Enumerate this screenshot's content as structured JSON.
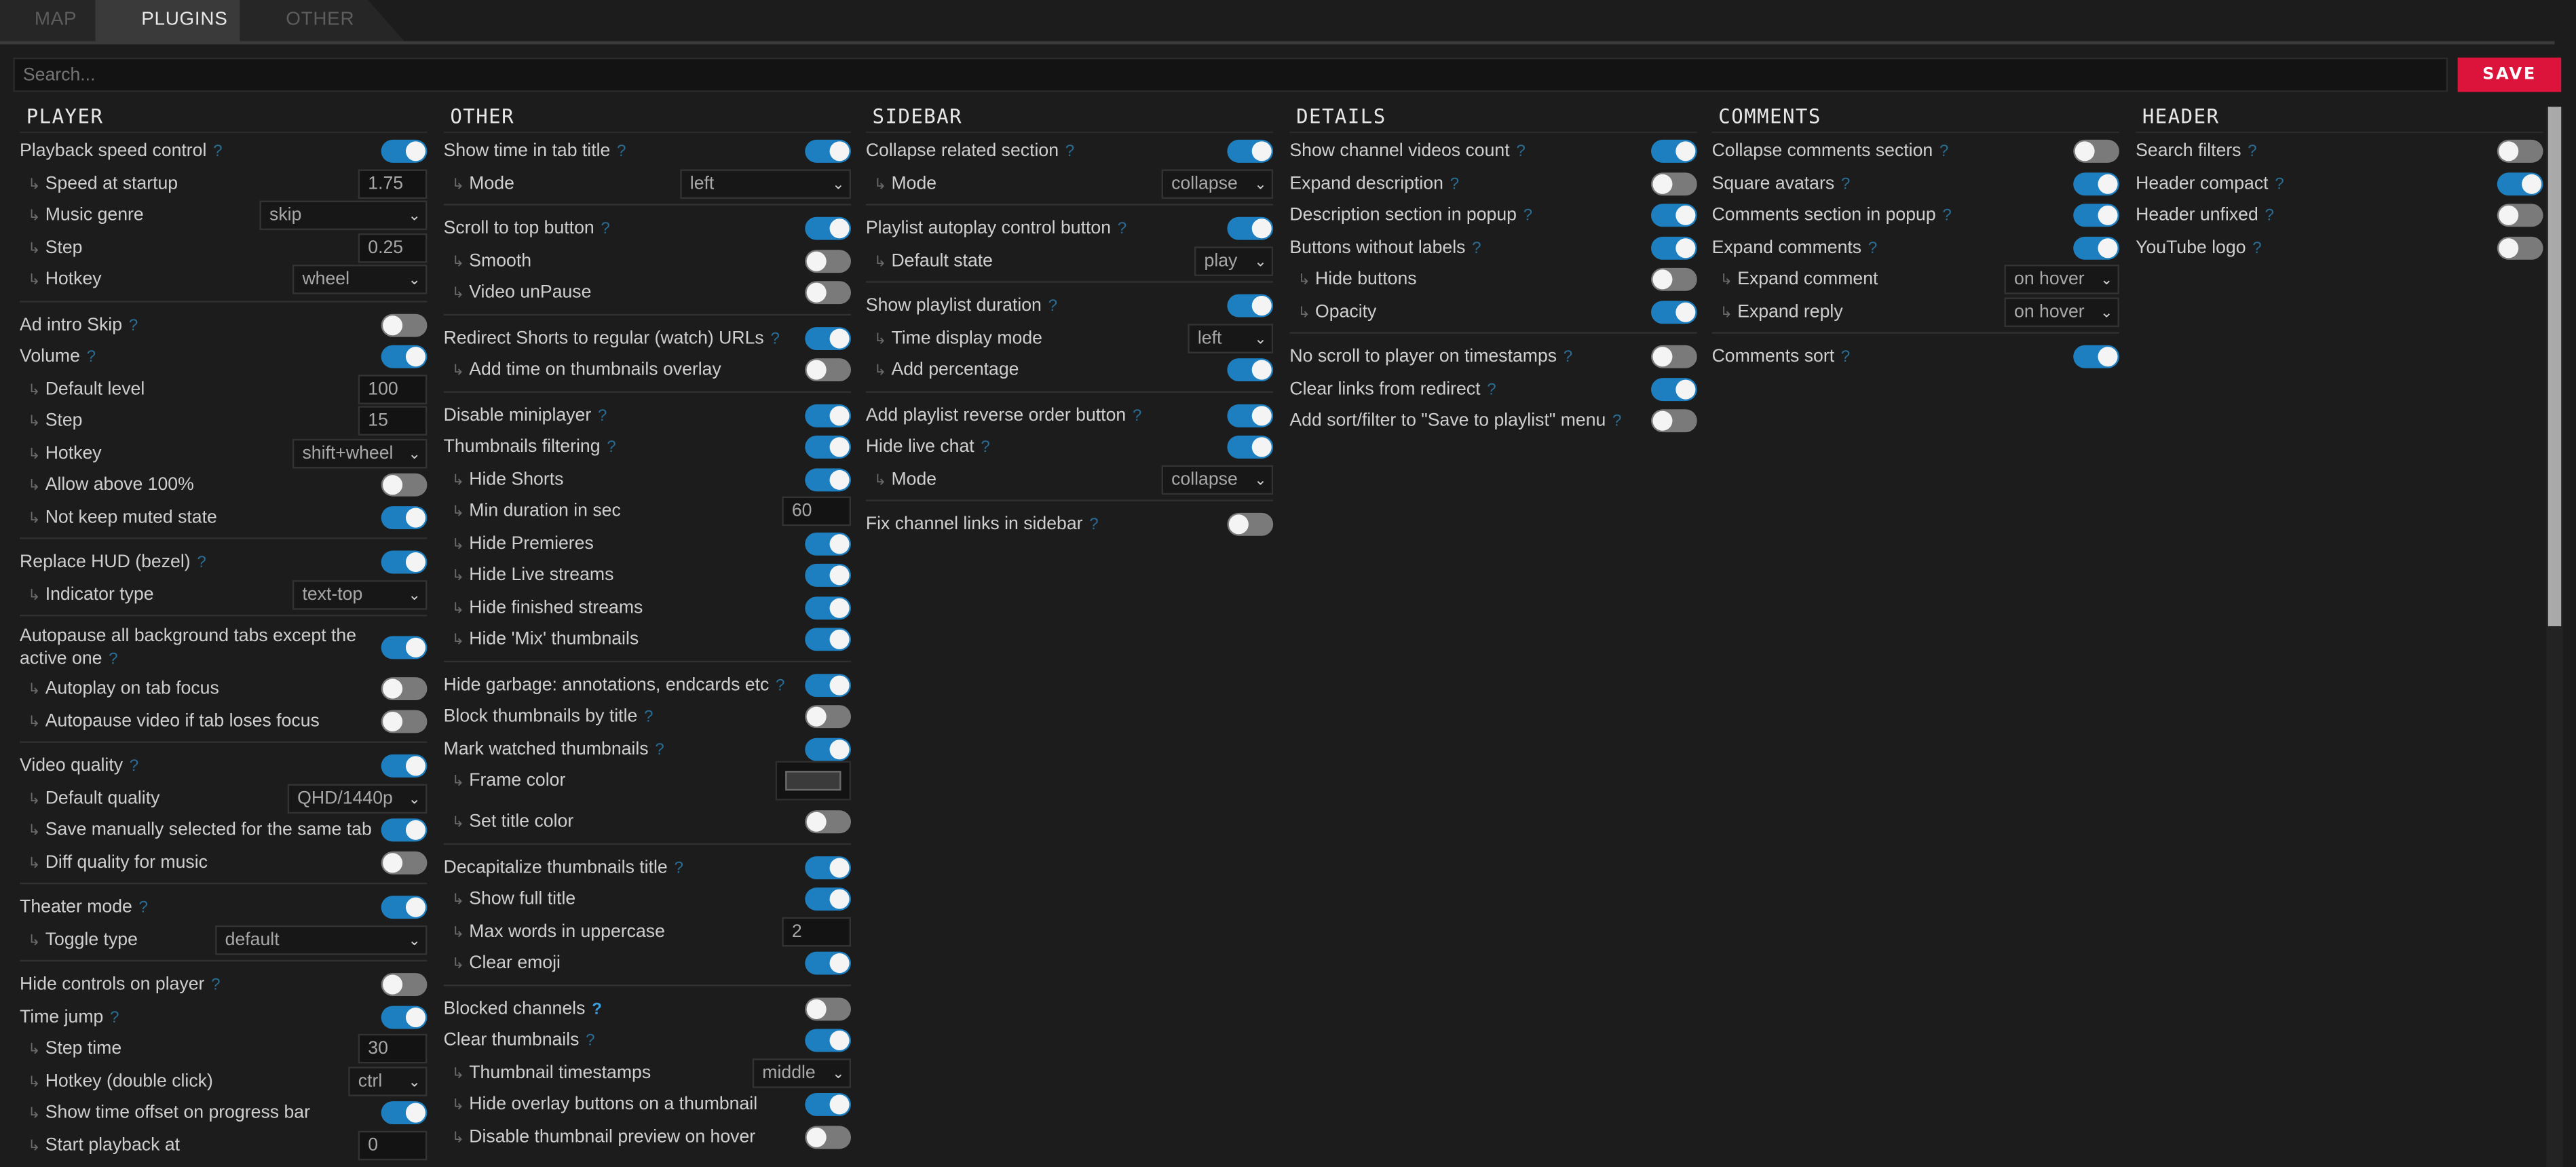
{
  "tabs": [
    "MAP",
    "PLUGINS",
    "OTHER"
  ],
  "search": {
    "placeholder": "Search..."
  },
  "save_label": "SAVE",
  "help_glyph": "?",
  "arrow_glyph": "↳",
  "columns": [
    {
      "title": "PLAYER",
      "rows": [
        {
          "t": "opt",
          "label": "Playback speed control",
          "help": true,
          "on": true
        },
        {
          "t": "sub",
          "label": "Speed at startup",
          "input": "1.75",
          "w": 42
        },
        {
          "t": "sub",
          "label": "Music genre",
          "select": "skip",
          "w": 102
        },
        {
          "t": "sub",
          "label": "Step",
          "input": "0.25",
          "w": 42
        },
        {
          "t": "sub",
          "label": "Hotkey",
          "select": "wheel",
          "w": 82
        },
        {
          "t": "sep"
        },
        {
          "t": "opt",
          "label": "Ad intro Skip",
          "help": true,
          "on": false
        },
        {
          "t": "opt",
          "label": "Volume",
          "help": true,
          "on": true
        },
        {
          "t": "sub",
          "label": "Default level",
          "input": "100",
          "w": 42
        },
        {
          "t": "sub",
          "label": "Step",
          "input": "15",
          "w": 42
        },
        {
          "t": "sub",
          "label": "Hotkey",
          "select": "shift+wheel",
          "w": 82
        },
        {
          "t": "sub",
          "label": "Allow above 100%",
          "on": false
        },
        {
          "t": "sub",
          "label": "Not keep muted state",
          "on": true
        },
        {
          "t": "sep"
        },
        {
          "t": "opt",
          "label": "Replace HUD (bezel)",
          "help": true,
          "on": true
        },
        {
          "t": "sub",
          "label": "Indicator type",
          "select": "text-top",
          "w": 82
        },
        {
          "t": "sep"
        },
        {
          "t": "opt2",
          "label": "Autopause all background tabs except the",
          "label2": "active one",
          "help": true,
          "on": true
        },
        {
          "t": "sub",
          "label": "Autoplay on tab focus",
          "on": false
        },
        {
          "t": "sub",
          "label": "Autopause video if tab loses focus",
          "on": false
        },
        {
          "t": "sep"
        },
        {
          "t": "opt",
          "label": "Video quality",
          "help": true,
          "on": true
        },
        {
          "t": "sub",
          "label": "Default quality",
          "select": "QHD/1440p",
          "w": 85
        },
        {
          "t": "sub",
          "label": "Save manually selected for the same tab",
          "on": true
        },
        {
          "t": "sub",
          "label": "Diff quality for music",
          "on": false
        },
        {
          "t": "sep"
        },
        {
          "t": "opt",
          "label": "Theater mode",
          "help": true,
          "on": true
        },
        {
          "t": "sub",
          "label": "Toggle type",
          "select": "default",
          "w": 129
        },
        {
          "t": "sep"
        },
        {
          "t": "opt",
          "label": "Hide controls on player",
          "help": true,
          "on": false
        },
        {
          "t": "opt",
          "label": "Time jump",
          "help": true,
          "on": true
        },
        {
          "t": "sub",
          "label": "Step time",
          "input": "30",
          "w": 42
        },
        {
          "t": "sub",
          "label": "Hotkey (double click)",
          "select": "ctrl",
          "w": 48
        },
        {
          "t": "sub",
          "label": "Show time offset on progress bar",
          "on": true
        },
        {
          "t": "sub",
          "label": "Start playback at",
          "input": "0",
          "w": 42
        }
      ]
    },
    {
      "title": "OTHER",
      "rows": [
        {
          "t": "opt",
          "label": "Show time in tab title",
          "help": true,
          "on": true
        },
        {
          "t": "sub",
          "label": "Mode",
          "select": "left",
          "w": 104
        },
        {
          "t": "sep"
        },
        {
          "t": "opt",
          "label": "Scroll to top button",
          "help": true,
          "on": true
        },
        {
          "t": "sub",
          "label": "Smooth",
          "on": false
        },
        {
          "t": "sub",
          "label": "Video unPause",
          "on": false
        },
        {
          "t": "sep"
        },
        {
          "t": "opt",
          "label": "Redirect Shorts to regular (watch) URLs",
          "help": true,
          "on": true
        },
        {
          "t": "sub",
          "label": "Add time on thumbnails overlay",
          "on": false
        },
        {
          "t": "sep"
        },
        {
          "t": "opt",
          "label": "Disable miniplayer",
          "help": true,
          "on": true
        },
        {
          "t": "opt",
          "label": "Thumbnails filtering",
          "help": true,
          "on": true
        },
        {
          "t": "sub",
          "label": "Hide Shorts",
          "on": true
        },
        {
          "t": "sub",
          "label": "Min duration in sec",
          "input": "60",
          "w": 42
        },
        {
          "t": "sub",
          "label": "Hide Premieres",
          "on": true
        },
        {
          "t": "sub",
          "label": "Hide Live streams",
          "on": true
        },
        {
          "t": "sub",
          "label": "Hide finished streams",
          "on": true
        },
        {
          "t": "sub",
          "label": "Hide 'Mix' thumbnails",
          "on": true
        },
        {
          "t": "sep"
        },
        {
          "t": "opt",
          "label": "Hide garbage: annotations, endcards etc",
          "help": true,
          "on": true
        },
        {
          "t": "opt",
          "label": "Block thumbnails by title",
          "help": true,
          "on": false
        },
        {
          "t": "opt",
          "label": "Mark watched thumbnails",
          "help": true,
          "on": true
        },
        {
          "t": "subc",
          "label": "Frame color",
          "color": "#3b3b3b"
        },
        {
          "t": "sub",
          "label": "Set title color",
          "on": false
        },
        {
          "t": "sep"
        },
        {
          "t": "opt",
          "label": "Decapitalize thumbnails title",
          "help": true,
          "on": true
        },
        {
          "t": "sub",
          "label": "Show full title",
          "on": true
        },
        {
          "t": "sub",
          "label": "Max words in uppercase",
          "input": "2",
          "w": 42
        },
        {
          "t": "sub",
          "label": "Clear emoji",
          "on": true
        },
        {
          "t": "sep"
        },
        {
          "t": "opt",
          "label": "Blocked channels",
          "help": true,
          "helpBright": true,
          "on": false
        },
        {
          "t": "opt",
          "label": "Clear thumbnails",
          "help": true,
          "on": true
        },
        {
          "t": "sub",
          "label": "Thumbnail timestamps",
          "select": "middle",
          "w": 60
        },
        {
          "t": "sub",
          "label": "Hide overlay buttons on a thumbnail",
          "on": true
        },
        {
          "t": "sub",
          "label": "Disable thumbnail preview on hover",
          "on": false
        }
      ]
    },
    {
      "title": "SIDEBAR",
      "rows": [
        {
          "t": "opt",
          "label": "Collapse related section",
          "help": true,
          "on": true
        },
        {
          "t": "sub",
          "label": "Mode",
          "select": "collapse",
          "w": 68
        },
        {
          "t": "sep"
        },
        {
          "t": "opt",
          "label": "Playlist autoplay control button",
          "help": true,
          "on": true
        },
        {
          "t": "sub",
          "label": "Default state",
          "select": "play",
          "w": 48
        },
        {
          "t": "sep"
        },
        {
          "t": "opt",
          "label": "Show playlist duration",
          "help": true,
          "on": true
        },
        {
          "t": "sub",
          "label": "Time display mode",
          "select": "left",
          "w": 52
        },
        {
          "t": "sub",
          "label": "Add percentage",
          "on": true
        },
        {
          "t": "sep"
        },
        {
          "t": "opt",
          "label": "Add playlist reverse order button",
          "help": true,
          "on": true
        },
        {
          "t": "opt",
          "label": "Hide live chat",
          "help": true,
          "on": true
        },
        {
          "t": "sub",
          "label": "Mode",
          "select": "collapse",
          "w": 68
        },
        {
          "t": "sep"
        },
        {
          "t": "opt",
          "label": "Fix channel links in sidebar",
          "help": true,
          "on": false
        }
      ]
    },
    {
      "title": "DETAILS",
      "rows": [
        {
          "t": "opt",
          "label": "Show channel videos count",
          "help": true,
          "on": true
        },
        {
          "t": "opt",
          "label": "Expand description",
          "help": true,
          "on": false
        },
        {
          "t": "opt",
          "label": "Description section in popup",
          "help": true,
          "on": true
        },
        {
          "t": "opt",
          "label": "Buttons without labels",
          "help": true,
          "on": true
        },
        {
          "t": "sub",
          "label": "Hide buttons",
          "on": false
        },
        {
          "t": "sub",
          "label": "Opacity",
          "on": true
        },
        {
          "t": "sep"
        },
        {
          "t": "opt",
          "label": "No scroll to player on timestamps",
          "help": true,
          "on": false
        },
        {
          "t": "opt",
          "label": "Clear links from redirect",
          "help": true,
          "on": true
        },
        {
          "t": "opt",
          "label": "Add sort/filter to \"Save to playlist\" menu",
          "help": true,
          "on": false
        }
      ]
    },
    {
      "title": "COMMENTS",
      "rows": [
        {
          "t": "opt",
          "label": "Collapse comments section",
          "help": true,
          "on": false
        },
        {
          "t": "opt",
          "label": "Square avatars",
          "help": true,
          "on": true
        },
        {
          "t": "opt",
          "label": "Comments section in popup",
          "help": true,
          "on": true
        },
        {
          "t": "opt",
          "label": "Expand comments",
          "help": true,
          "on": true
        },
        {
          "t": "sub",
          "label": "Expand comment",
          "select": "on hover",
          "w": 70
        },
        {
          "t": "sub",
          "label": "Expand reply",
          "select": "on hover",
          "w": 70
        },
        {
          "t": "sep"
        },
        {
          "t": "opt",
          "label": "Comments sort",
          "help": true,
          "on": true
        }
      ]
    },
    {
      "title": "HEADER",
      "rows": [
        {
          "t": "opt",
          "label": "Search filters",
          "help": true,
          "on": false
        },
        {
          "t": "opt",
          "label": "Header compact",
          "help": true,
          "on": true
        },
        {
          "t": "opt",
          "label": "Header unfixed",
          "help": true,
          "on": false
        },
        {
          "t": "opt",
          "label": "YouTube logo",
          "help": true,
          "on": false
        }
      ]
    }
  ]
}
